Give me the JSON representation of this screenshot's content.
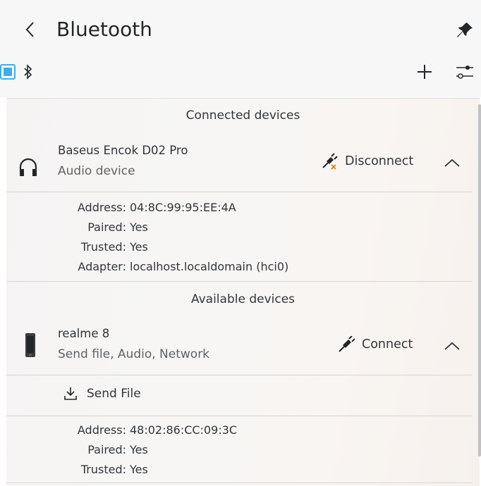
{
  "header": {
    "title": "Bluetooth",
    "back_label": "<"
  },
  "sections": {
    "connected": "Connected devices",
    "available": "Available devices"
  },
  "connected_device": {
    "name": "Baseus Encok D02 Pro",
    "type": "Audio device",
    "action": "Disconnect",
    "info": [
      {
        "label": "Address:",
        "value": "04:8C:99:95:EE:4A"
      },
      {
        "label": "Paired:",
        "value": "Yes"
      },
      {
        "label": "Trusted:",
        "value": "Yes"
      },
      {
        "label": "Adapter:",
        "value": "localhost.localdomain (hci0)"
      }
    ]
  },
  "available_device": {
    "name": "realme 8",
    "type": "Send file, Audio, Network",
    "action": "Connect",
    "send_file": "Send File",
    "info": [
      {
        "label": "Address:",
        "value": "48:02:86:CC:09:3C"
      },
      {
        "label": "Paired:",
        "value": "Yes"
      },
      {
        "label": "Trusted:",
        "value": "Yes"
      }
    ]
  },
  "colors": {
    "accent": "#3daee9",
    "text": "#232629",
    "muted": "#5f6265"
  }
}
